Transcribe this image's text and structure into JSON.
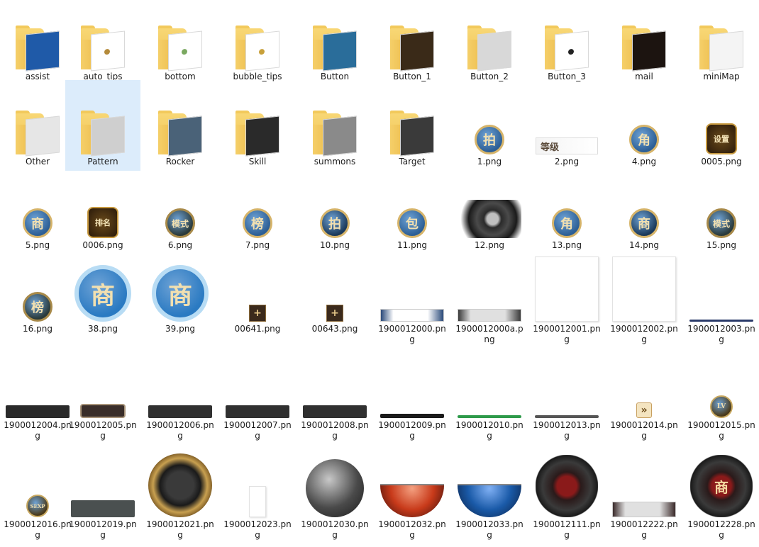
{
  "rows": [
    {
      "items": [
        {
          "label": "assist",
          "kind": "folder",
          "paper": "#1f5aa8"
        },
        {
          "label": "auto_tips",
          "kind": "folder",
          "paper": "#ffffff",
          "dot": "#b48a3a"
        },
        {
          "label": "bottom",
          "kind": "folder",
          "paper": "#ffffff",
          "dot": "#7aa860"
        },
        {
          "label": "bubble_tips",
          "kind": "folder",
          "paper": "#ffffff",
          "dot": "#c8a03a"
        },
        {
          "label": "Button",
          "kind": "folder",
          "paper": "#2a6d9a"
        },
        {
          "label": "Button_1",
          "kind": "folder",
          "paper": "#3a2a18"
        },
        {
          "label": "Button_2",
          "kind": "folder",
          "paper": "#d8d8d8"
        },
        {
          "label": "Button_3",
          "kind": "folder",
          "paper": "#ffffff",
          "dot": "#222222"
        },
        {
          "label": "mail",
          "kind": "folder",
          "paper": "#1c1410"
        },
        {
          "label": "miniMap",
          "kind": "folder",
          "paper": "#f4f4f4"
        }
      ]
    },
    {
      "items": [
        {
          "label": "Other",
          "kind": "folder",
          "paper": "#e6e6e6"
        },
        {
          "label": "Pattern",
          "kind": "folder",
          "paper": "#cfcfcf",
          "selected": true
        },
        {
          "label": "Rocker",
          "kind": "folder",
          "paper": "#4a6278"
        },
        {
          "label": "Skill",
          "kind": "folder",
          "paper": "#2a2a2a"
        },
        {
          "label": "summons",
          "kind": "folder",
          "paper": "#8a8a8a"
        },
        {
          "label": "Target",
          "kind": "folder",
          "paper": "#3a3a3a"
        },
        {
          "label": "1.png",
          "kind": "coin",
          "glyph": "拍",
          "bg": "#2d5f95",
          "rim": "#d6b46a",
          "size": 36
        },
        {
          "label": "2.png",
          "kind": "badge",
          "glyph": "等级"
        },
        {
          "label": "4.png",
          "kind": "coin",
          "glyph": "角",
          "bg": "#2d5f95",
          "rim": "#d6b46a",
          "size": 36
        },
        {
          "label": "0005.png",
          "kind": "gear",
          "glyph": "设置"
        }
      ]
    },
    {
      "items": [
        {
          "label": "5.png",
          "kind": "coin",
          "glyph": "商",
          "bg": "#2d5f95",
          "rim": "#d6b46a",
          "size": 36
        },
        {
          "label": "0006.png",
          "kind": "gear",
          "glyph": "排名"
        },
        {
          "label": "6.png",
          "kind": "coin",
          "glyph": "模式",
          "bg": "#2a3a3a",
          "rim": "#a88a4a",
          "size": 36
        },
        {
          "label": "7.png",
          "kind": "coin",
          "glyph": "榜",
          "bg": "#2d5f95",
          "rim": "#d6b46a",
          "size": 36
        },
        {
          "label": "10.png",
          "kind": "coin",
          "glyph": "拍",
          "bg": "#1c3a5a",
          "rim": "#d6b46a",
          "size": 36
        },
        {
          "label": "11.png",
          "kind": "coin",
          "glyph": "包",
          "bg": "#2d5f95",
          "rim": "#d6b46a",
          "size": 36
        },
        {
          "label": "12.png",
          "kind": "dragon"
        },
        {
          "label": "13.png",
          "kind": "coin",
          "glyph": "角",
          "bg": "#2d5f95",
          "rim": "#d6b46a",
          "size": 36
        },
        {
          "label": "14.png",
          "kind": "coin",
          "glyph": "商",
          "bg": "#1c3a5a",
          "rim": "#d6b46a",
          "size": 36
        },
        {
          "label": "15.png",
          "kind": "coin",
          "glyph": "模式",
          "bg": "#2a3a3a",
          "rim": "#a88a4a",
          "size": 36
        }
      ]
    },
    {
      "items": [
        {
          "label": "16.png",
          "kind": "coin",
          "glyph": "榜",
          "bg": "#2a3a3a",
          "rim": "#a88a4a",
          "size": 36
        },
        {
          "label": "38.png",
          "kind": "coin",
          "glyph": "商",
          "bg": "#2a7ac2",
          "rim": "#b8dcf4",
          "size": 68
        },
        {
          "label": "39.png",
          "kind": "coin",
          "glyph": "商",
          "bg": "#2a7ac2",
          "rim": "#b8dcf4",
          "size": 68
        },
        {
          "label": "00641.png",
          "kind": "plus",
          "glyph": "+"
        },
        {
          "label": "00643.png",
          "kind": "plus",
          "glyph": "+"
        },
        {
          "label": "1900012000.png",
          "kind": "strip",
          "c1": "#ffffff",
          "c2": "#2a4a7a",
          "h": 18
        },
        {
          "label": "1900012000a.png",
          "kind": "strip",
          "c1": "#e0e0e0",
          "c2": "#3a3a3a",
          "h": 18
        },
        {
          "label": "1900012001.png",
          "kind": "blank",
          "h": 90
        },
        {
          "label": "1900012002.png",
          "kind": "blank",
          "h": 90
        },
        {
          "label": "1900012003.png",
          "kind": "bar",
          "color": "#2a3a6a",
          "h": 3
        }
      ]
    },
    {
      "items": [
        {
          "label": "1900012004.png",
          "kind": "bar",
          "color": "#2a2a2a",
          "h": 18
        },
        {
          "label": "1900012005.png",
          "kind": "bar",
          "color": "#3a2e2a",
          "h": 16,
          "rim": "#a8947a"
        },
        {
          "label": "1900012006.png",
          "kind": "bar",
          "color": "#303030",
          "h": 18
        },
        {
          "label": "1900012007.png",
          "kind": "bar",
          "color": "#303030",
          "h": 18
        },
        {
          "label": "1900012008.png",
          "kind": "bar",
          "color": "#303030",
          "h": 18
        },
        {
          "label": "1900012009.png",
          "kind": "bar",
          "color": "#1a1a1a",
          "h": 6
        },
        {
          "label": "1900012010.png",
          "kind": "bar",
          "color": "#2e9a4a",
          "h": 4
        },
        {
          "label": "1900012013.png",
          "kind": "bar",
          "color": "#555555",
          "h": 4
        },
        {
          "label": "1900012014.png",
          "kind": "arrow",
          "glyph": "»"
        },
        {
          "label": "1900012015.png",
          "kind": "coin",
          "glyph": "LV",
          "bg": "#4a3a1a",
          "rim": "#c8a860",
          "size": 28
        }
      ]
    },
    {
      "items": [
        {
          "label": "1900012016.png",
          "kind": "coin",
          "glyph": "SEXP",
          "bg": "#4a3a1a",
          "rim": "#c8a860",
          "size": 28
        },
        {
          "label": "1900012019.png",
          "kind": "bar",
          "color": "#4a5050",
          "h": 24
        },
        {
          "label": "1900012021.png",
          "kind": "ring",
          "bg": "#1a1a1a",
          "rim": "#c8a050",
          "size": 90
        },
        {
          "label": "1900012023.png",
          "kind": "blank",
          "h": 42,
          "w": 22
        },
        {
          "label": "1900012030.png",
          "kind": "orb",
          "bg": "#4a4a4a",
          "size": 82
        },
        {
          "label": "1900012032.png",
          "kind": "halforb",
          "bg": "#c83a1a",
          "size": 90
        },
        {
          "label": "1900012033.png",
          "kind": "halforb",
          "bg": "#1a5aa8",
          "size": 90
        },
        {
          "label": "1900012111.png",
          "kind": "dragonring"
        },
        {
          "label": "1900012222.png",
          "kind": "strip",
          "c1": "#e0e0e0",
          "c2": "#3a2a2a",
          "h": 22
        },
        {
          "label": "1900012228.png",
          "kind": "dragonring2",
          "glyph": "商"
        }
      ]
    }
  ]
}
